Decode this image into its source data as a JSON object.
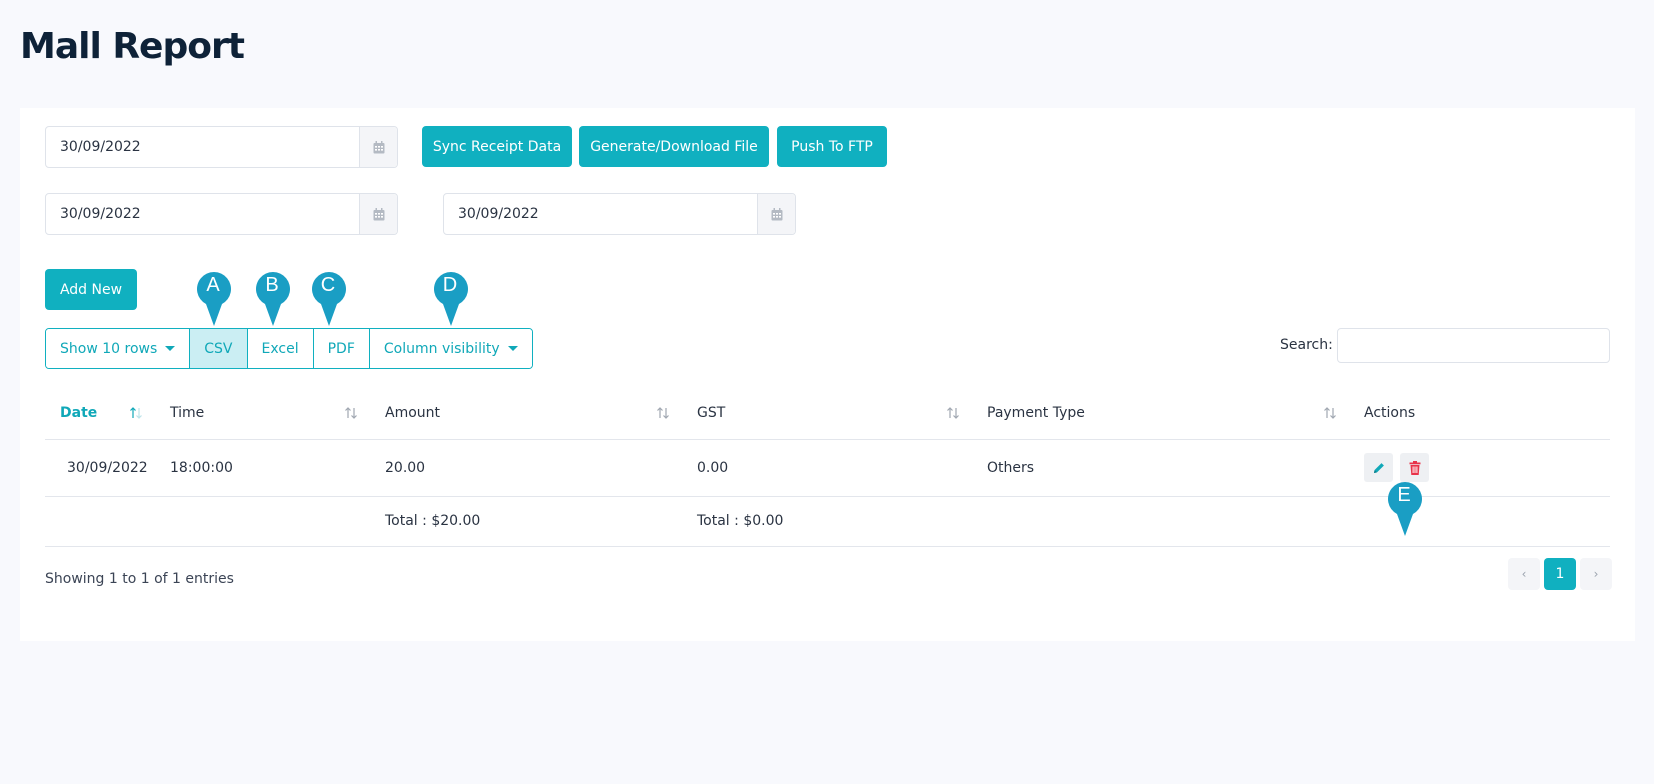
{
  "page": {
    "title": "Mall Report"
  },
  "filters": {
    "date_main": "30/09/2022",
    "date_from": "30/09/2022",
    "date_to": "30/09/2022",
    "calendar_icon": "calendar-icon"
  },
  "actions": {
    "sync_label": "Sync Receipt Data",
    "generate_label": "Generate/Download File",
    "ftp_label": "Push To FTP",
    "add_new_label": "Add New"
  },
  "toolbar": {
    "show_rows_label": "Show 10 rows",
    "csv_label": "CSV",
    "excel_label": "Excel",
    "pdf_label": "PDF",
    "column_visibility_label": "Column visibility",
    "search_label": "Search:",
    "search_value": ""
  },
  "table": {
    "headers": [
      "Date",
      "Time",
      "Amount",
      "GST",
      "Payment Type",
      "Actions"
    ],
    "rows": [
      {
        "date": "30/09/2022",
        "time": "18:00:00",
        "amount": "20.00",
        "gst": "0.00",
        "payment_type": "Others"
      }
    ],
    "totals": {
      "amount": "Total : $20.00",
      "gst": "Total : $0.00"
    }
  },
  "footer": {
    "info": "Showing 1 to 1 of 1 entries",
    "prev": "‹",
    "current_page": "1",
    "next": "›"
  },
  "markers": [
    "A",
    "B",
    "C",
    "D",
    "E"
  ],
  "colors": {
    "accent": "#10b0c0",
    "title": "#0e2238",
    "danger": "#e8334a",
    "marker": "#1a9ec4"
  }
}
